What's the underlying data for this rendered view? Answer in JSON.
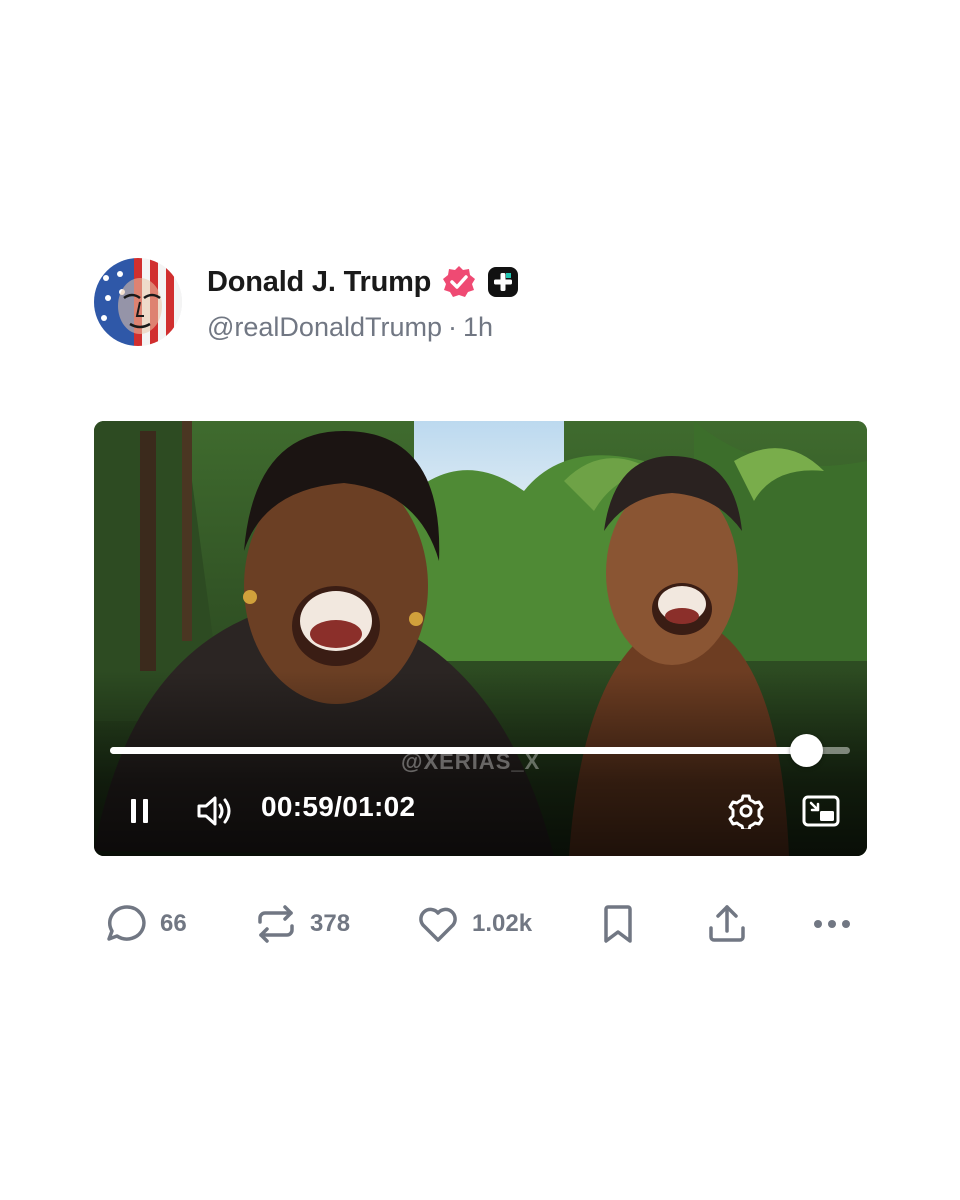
{
  "post": {
    "display_name": "Donald J. Trump",
    "handle": "@realDonaldTrump",
    "separator": "·",
    "time_ago": "1h"
  },
  "badges": {
    "verified_icon": "verified-check-badge",
    "verified_color": "#ef4a73",
    "plus_icon": "plus-badge",
    "plus_color": "#111111"
  },
  "video": {
    "watermark": "@XERIAS_X",
    "current_time": "00:59",
    "time_separator": "/",
    "duration": "01:02",
    "progress_fraction": 0.94,
    "controls": [
      "pause-icon",
      "volume-icon",
      "settings-gear-icon",
      "picture-in-picture-icon"
    ]
  },
  "actions": {
    "replies": "66",
    "reposts": "378",
    "likes": "1.02k",
    "icon_color": "#717783",
    "icons": [
      "reply-bubble-icon",
      "repost-icon",
      "heart-icon",
      "bookmark-icon",
      "share-upload-icon",
      "more-dots-icon"
    ]
  }
}
